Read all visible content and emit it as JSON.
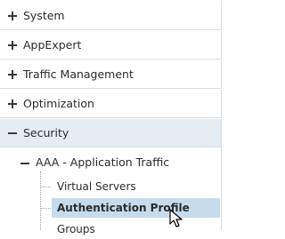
{
  "nav": {
    "items": [
      {
        "label": "System",
        "expanded": false
      },
      {
        "label": "AppExpert",
        "expanded": false
      },
      {
        "label": "Traffic Management",
        "expanded": false
      },
      {
        "label": "Optimization",
        "expanded": false
      },
      {
        "label": "Security",
        "expanded": true
      }
    ],
    "security_subtree": {
      "group_label": "AAA - Application Traffic",
      "children": [
        {
          "label": "Virtual Servers",
          "selected": false
        },
        {
          "label": "Authentication Profile",
          "selected": true
        },
        {
          "label": "Groups",
          "selected": false
        }
      ]
    }
  },
  "colors": {
    "expanded_bg": "#e4edf4",
    "selected_bg": "#c6dcec",
    "divider": "#d8dde2"
  },
  "icons": {
    "expand": "plus-icon",
    "collapse": "minus-icon",
    "pointer": "mouse-pointer-icon"
  }
}
